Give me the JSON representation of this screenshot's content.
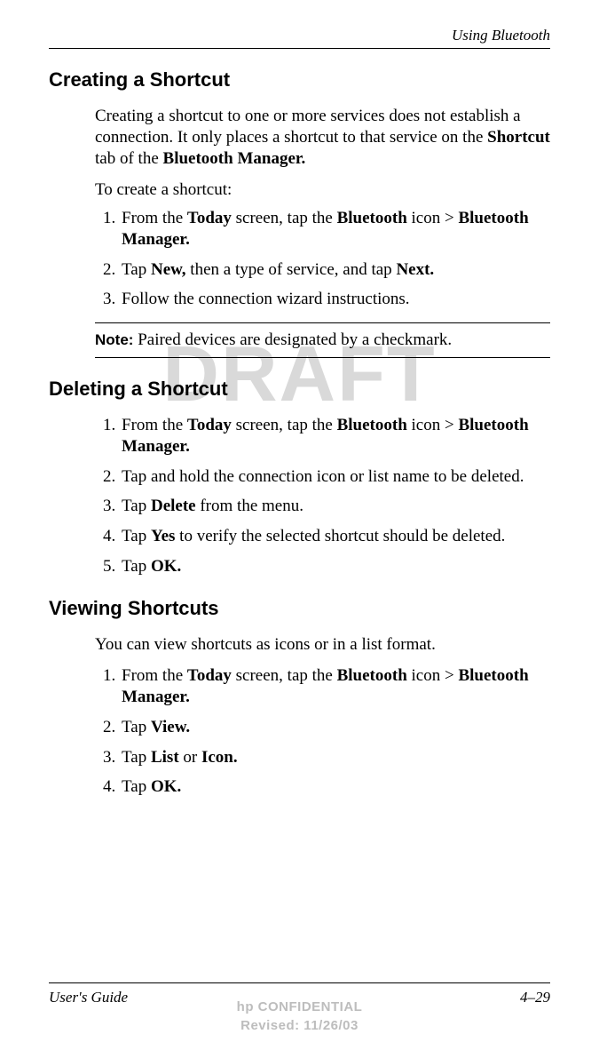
{
  "header": {
    "chapter": "Using Bluetooth"
  },
  "watermark": "DRAFT",
  "sections": {
    "creating": {
      "title": "Creating a Shortcut",
      "intro_p1": "Creating a shortcut to one or more services does not establish a connection. It only places a shortcut to that service on the ",
      "intro_b1": "Shortcut",
      "intro_p2": " tab of the ",
      "intro_b2": "Bluetooth Manager.",
      "lead": "To create a shortcut:",
      "steps": {
        "s1_a": "From the ",
        "s1_b1": "Today",
        "s1_b": " screen, tap the ",
        "s1_b2": "Bluetooth",
        "s1_c": " icon > ",
        "s1_b3": "Bluetooth Manager.",
        "s2_a": "Tap ",
        "s2_b1": "New,",
        "s2_b": " then a type of service, and tap ",
        "s2_b2": "Next.",
        "s3": "Follow the connection wizard instructions."
      },
      "note_label": "Note:",
      "note_text": " Paired devices are designated by a checkmark."
    },
    "deleting": {
      "title": "Deleting a Shortcut",
      "steps": {
        "s1_a": "From the ",
        "s1_b1": "Today",
        "s1_b": " screen, tap the ",
        "s1_b2": "Bluetooth",
        "s1_c": " icon > ",
        "s1_b3": "Bluetooth Manager.",
        "s2": "Tap and hold the connection icon or list name to be deleted.",
        "s3_a": "Tap ",
        "s3_b1": "Delete",
        "s3_b": " from the menu.",
        "s4_a": "Tap ",
        "s4_b1": "Yes",
        "s4_b": " to verify the selected shortcut should be deleted.",
        "s5_a": "Tap ",
        "s5_b1": "OK."
      }
    },
    "viewing": {
      "title": "Viewing Shortcuts",
      "intro": "You can view shortcuts as icons or in a list format.",
      "steps": {
        "s1_a": "From the ",
        "s1_b1": "Today",
        "s1_b": " screen, tap the ",
        "s1_b2": "Bluetooth",
        "s1_c": " icon > ",
        "s1_b3": "Bluetooth Manager.",
        "s2_a": "Tap ",
        "s2_b1": "View.",
        "s3_a": "Tap ",
        "s3_b1": "List",
        "s3_b": " or ",
        "s3_b2": "Icon.",
        "s4_a": "Tap ",
        "s4_b1": "OK."
      }
    }
  },
  "footer": {
    "left": "User's Guide",
    "right": "4–29",
    "confidential": "hp CONFIDENTIAL",
    "revised": "Revised: 11/26/03"
  }
}
